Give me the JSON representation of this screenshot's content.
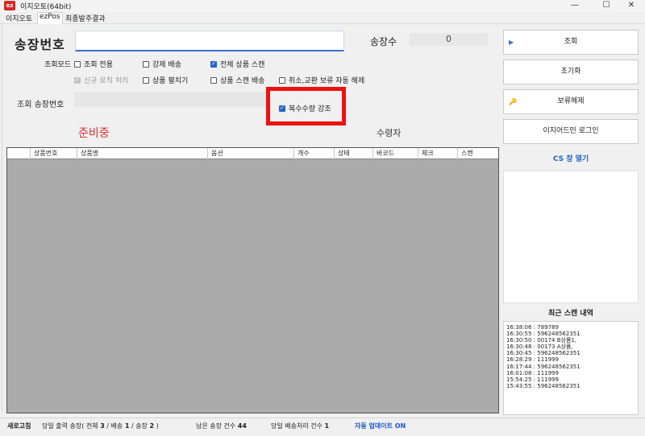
{
  "window": {
    "title": "이지오토(64bit)",
    "logo_text": "ez",
    "minimize": "—",
    "maximize": "☐",
    "close": "✕"
  },
  "menu": [
    "이지오토",
    "ezPos",
    "최종발주결과"
  ],
  "invoice": {
    "label": "송장번호",
    "value": "",
    "count_label": "송장수",
    "count_value": "0"
  },
  "lookup_mode": {
    "label": "조회모드",
    "options": [
      {
        "label": "조회 전용",
        "checked": false,
        "disabled": false
      },
      {
        "label": "강제 배송",
        "checked": false,
        "disabled": false
      },
      {
        "label": "전체 상품 스캔",
        "checked": true,
        "disabled": false
      },
      {
        "label": "신규 로직 처리",
        "checked": true,
        "disabled": true
      },
      {
        "label": "상품 펼치기",
        "checked": false,
        "disabled": false
      },
      {
        "label": "상품 스캔 배송",
        "checked": false,
        "disabled": false
      },
      {
        "label": "취소,교환 보류 자동 해제",
        "checked": false,
        "disabled": false
      },
      {
        "label": "복수수량 강조",
        "checked": true,
        "disabled": false
      }
    ]
  },
  "lookup_invoice": {
    "label": "조회 송장번호",
    "value": ""
  },
  "status_text": "준비중",
  "receiver_label": "수령자",
  "grid": {
    "columns": [
      "",
      "상품번호",
      "상품명",
      "옵션",
      "개수",
      "상태",
      "바코드",
      "체크",
      "스캔"
    ]
  },
  "statusbar": {
    "refresh": "새로고침",
    "today_prefix": "당일 출력 송장( 전체",
    "total": "3",
    "ship_label": "/ 배송",
    "ship": "1",
    "invoice_label": "/ 송장",
    "invoice": "2",
    "close_paren": ")",
    "remaining_label": "남은 송장 건수",
    "remaining": "44",
    "today_ship_label": "당일 배송처리 건수",
    "today_ship": "1",
    "auto_update": "자동 업데이트 ON"
  },
  "side": {
    "buttons": [
      {
        "label": "조회",
        "icon": "play-icon"
      },
      {
        "label": "초기화",
        "icon": ""
      },
      {
        "label": "보류해제",
        "icon": "key-icon"
      },
      {
        "label": "이지어드민 로그인",
        "icon": ""
      }
    ],
    "cs_link": "CS 창 열기",
    "recent_title": "최근 스캔 내역",
    "recent": [
      "16:38:06 :  789789",
      "16:30:55 :  596248562351",
      "16:30:50 :  00174 B상품1,",
      "16:30:48 :  00173 A상품,",
      "16:30:45 :  596248562351",
      "16:28:29 :  111999",
      "16:17:44 :  596248562351",
      "16:01:08 :  111999",
      "15:54:25 :  111999",
      "15:43:55 :  596248562351"
    ]
  },
  "colors": {
    "accent": "#2763c8",
    "alert": "#ee1111",
    "ready": "#e23030",
    "link": "#1f63c9"
  }
}
